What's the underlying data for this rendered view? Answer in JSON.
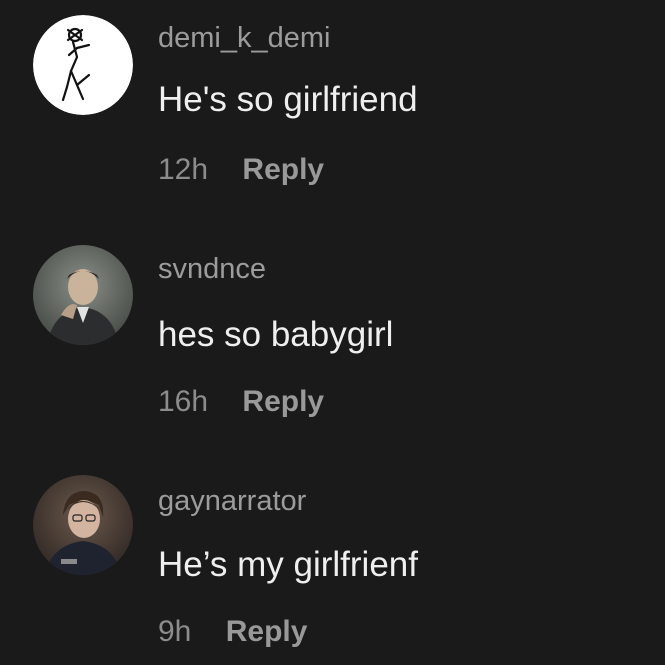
{
  "comments": [
    {
      "username": "demi_k_demi",
      "text": "He's so girlfriend",
      "time": "12h",
      "reply_label": "Reply",
      "avatar_icon": "stick-figure-avatar"
    },
    {
      "username": "svndnce",
      "text": "hes so babygirl",
      "time": "16h",
      "reply_label": "Reply",
      "avatar_icon": "man-in-suit-avatar"
    },
    {
      "username": "gaynarrator",
      "text": "He’s my girlfrienf",
      "time": "9h",
      "reply_label": "Reply",
      "avatar_icon": "young-man-avatar"
    }
  ],
  "colors": {
    "background": "#1a1a1a",
    "username": "#9c9c9c",
    "comment_text": "#efefef",
    "reply": "#999999"
  }
}
